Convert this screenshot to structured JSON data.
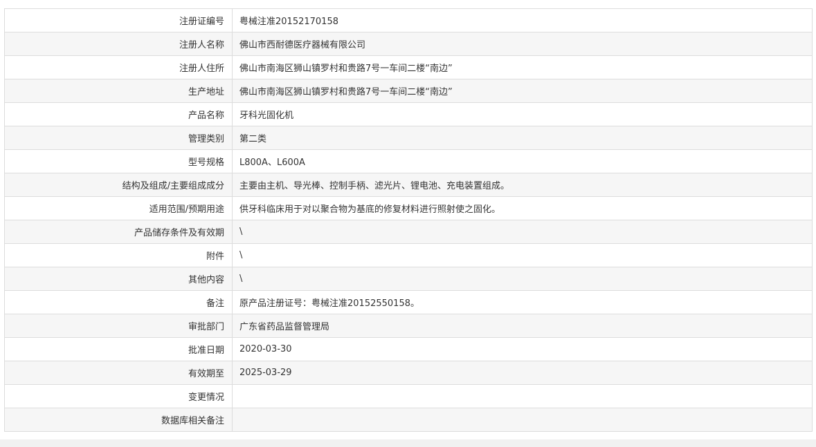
{
  "rows": [
    {
      "label": "注册证编号",
      "value": "粤械注准20152170158"
    },
    {
      "label": "注册人名称",
      "value": "佛山市西耐德医疗器械有限公司"
    },
    {
      "label": "注册人住所",
      "value": "佛山市南海区狮山镇罗村和贵路7号一车间二楼“南边”"
    },
    {
      "label": "生产地址",
      "value": "佛山市南海区狮山镇罗村和贵路7号一车间二楼“南边”"
    },
    {
      "label": "产品名称",
      "value": "牙科光固化机"
    },
    {
      "label": "管理类别",
      "value": "第二类"
    },
    {
      "label": "型号规格",
      "value": "L800A、L600A"
    },
    {
      "label": "结构及组成/主要组成成分",
      "value": "主要由主机、导光棒、控制手柄、滤光片、锂电池、充电装置组成。"
    },
    {
      "label": "适用范围/预期用途",
      "value": "供牙科临床用于对以聚合物为基底的修复材料进行照射使之固化。"
    },
    {
      "label": "产品储存条件及有效期",
      "value": "\\"
    },
    {
      "label": "附件",
      "value": "\\"
    },
    {
      "label": "其他内容",
      "value": "\\"
    },
    {
      "label": "备注",
      "value": "原产品注册证号：粤械注准20152550158。"
    },
    {
      "label": "审批部门",
      "value": "广东省药品监督管理局"
    },
    {
      "label": "批准日期",
      "value": "2020-03-30"
    },
    {
      "label": "有效期至",
      "value": "2025-03-29"
    },
    {
      "label": "变更情况",
      "value": ""
    },
    {
      "label": "数据库相关备注",
      "value": ""
    }
  ]
}
